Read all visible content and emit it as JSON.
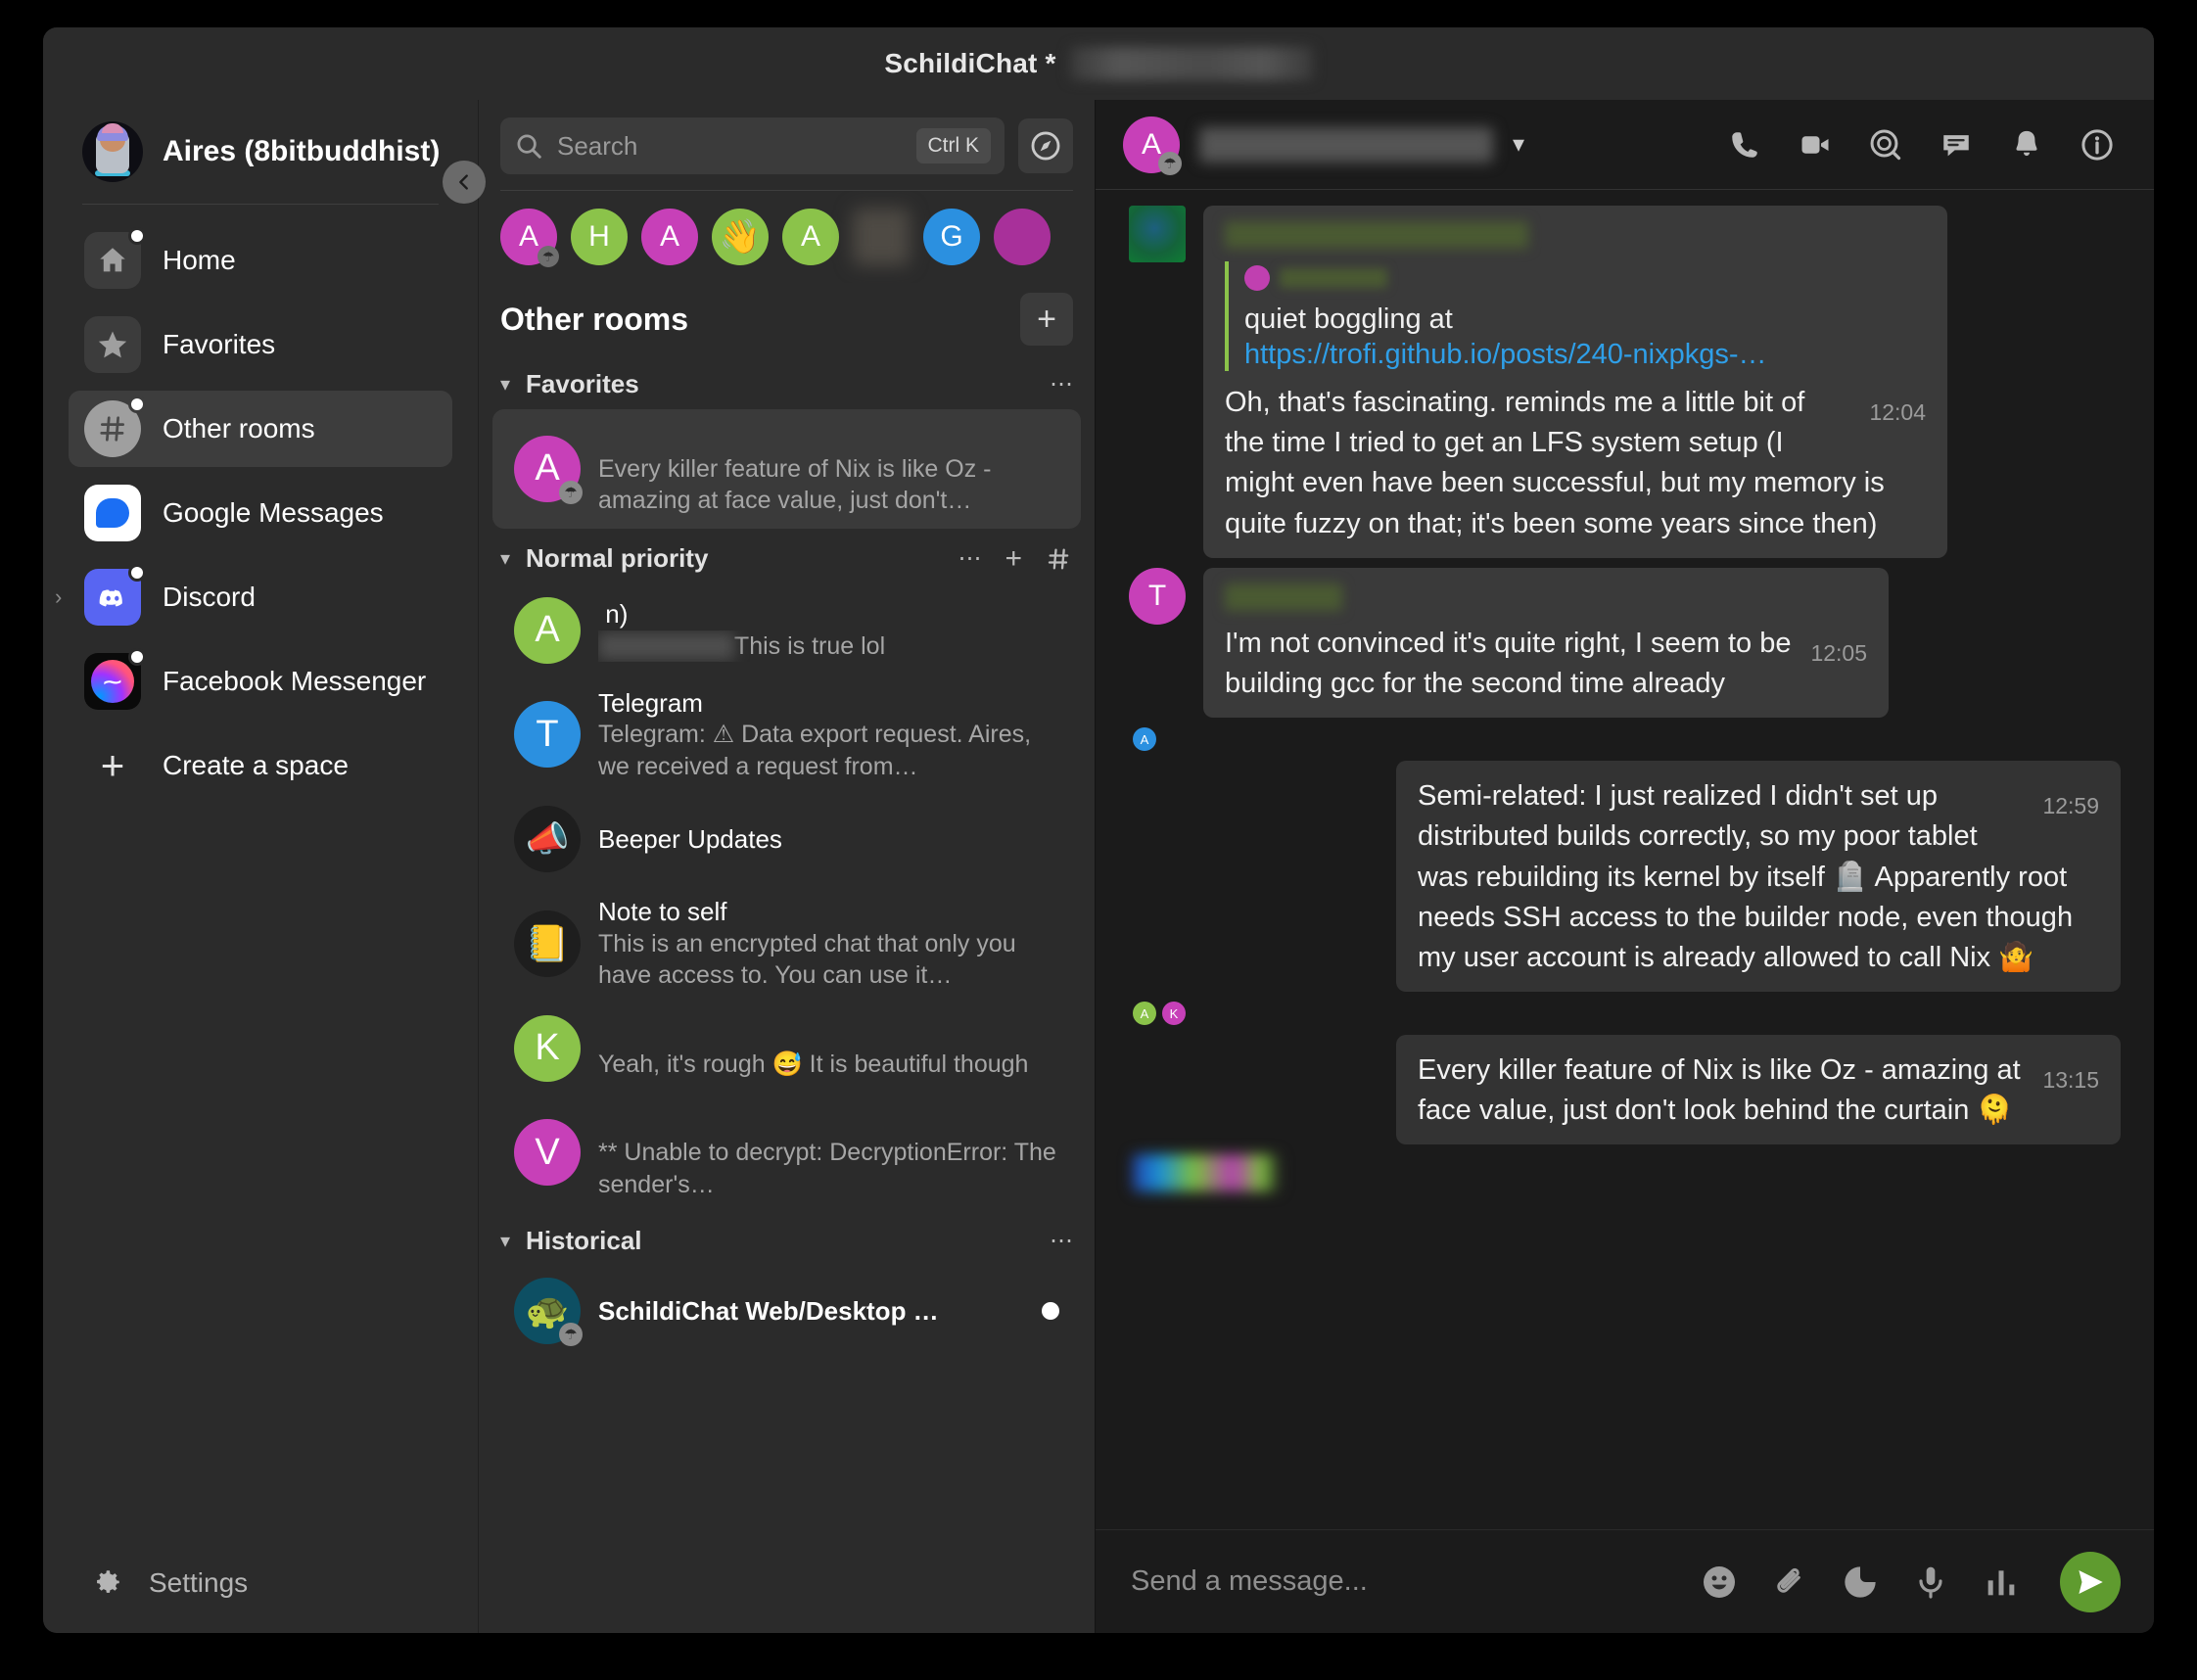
{
  "window": {
    "title_app": "SchildiChat *",
    "title_room_redacted": true
  },
  "sidebar": {
    "user": {
      "name": "Aires (8bitbuddhist)",
      "avatar": "user-avatar"
    },
    "collapse_icon": "chevron-left-icon",
    "items": [
      {
        "label": "Home",
        "icon": "home-icon",
        "badge": true,
        "selected": false
      },
      {
        "label": "Favorites",
        "icon": "star-icon",
        "badge": false,
        "selected": false
      },
      {
        "label": "Other rooms",
        "icon": "hash-icon",
        "badge": true,
        "selected": true
      },
      {
        "label": "Google Messages",
        "icon": "google-messages-icon",
        "badge": false,
        "selected": false
      },
      {
        "label": "Discord",
        "icon": "discord-icon",
        "badge": true,
        "selected": false,
        "expandable": true
      },
      {
        "label": "Facebook Messenger",
        "icon": "facebook-messenger-icon",
        "badge": true,
        "selected": false
      }
    ],
    "create_space_label": "Create a space",
    "settings_label": "Settings",
    "settings_icon": "gear-icon"
  },
  "roomlist": {
    "search": {
      "placeholder": "Search",
      "shortcut": "Ctrl K",
      "icon": "search-icon"
    },
    "explore_icon": "explore-compass-icon",
    "avatar_strip": [
      {
        "letter": "A",
        "color": "#c740b8",
        "globe": true
      },
      {
        "letter": "H",
        "color": "#8bc34a",
        "globe": false
      },
      {
        "letter": "A",
        "color": "#c740b8",
        "globe": false
      },
      {
        "letter": "👋",
        "color": "#8bc34a",
        "globe": false
      },
      {
        "letter": "A",
        "color": "#8bc34a",
        "globe": false
      },
      {
        "letter": "",
        "color": "#4a4a4a",
        "globe": false,
        "blurred": true
      },
      {
        "letter": "G",
        "color": "#2b90e0",
        "globe": false
      },
      {
        "letter": "",
        "color": "#a8309a",
        "globe": false
      }
    ],
    "header": {
      "title": "Other rooms",
      "add_icon": "plus-icon"
    },
    "sections": [
      {
        "name": "Favorites",
        "icons": [
          "overflow-icon"
        ],
        "rooms": [
          {
            "name_redacted": true,
            "name": "",
            "preview": "Every killer feature of Nix is like Oz - amazing at face value, just don't…",
            "preview_redacted_prefix": "",
            "avatar": {
              "letter": "A",
              "color": "#c740b8",
              "globe": true
            },
            "selected": true,
            "unread": false
          }
        ]
      },
      {
        "name": "Normal priority",
        "icons": [
          "overflow-icon",
          "plus-icon",
          "add-room-icon"
        ],
        "rooms": [
          {
            "name_redacted": true,
            "name": "",
            "name_suffix": "n)",
            "preview": "This is true lol",
            "preview_redacted_prefix": "  ",
            "avatar": {
              "letter": "A",
              "color": "#8bc34a",
              "globe": false
            },
            "selected": false,
            "unread": false
          },
          {
            "name_redacted": false,
            "name": "Telegram",
            "preview": "Telegram: ⚠ Data export request. Aires, we received a request from…",
            "avatar": {
              "letter": "T",
              "color": "#2b90e0",
              "globe": false
            },
            "selected": false,
            "unread": false
          },
          {
            "name_redacted": false,
            "name": "Beeper Updates",
            "preview": "",
            "avatar": {
              "letter": "📣",
              "color": "#1e1e1e",
              "globe": false
            },
            "selected": false,
            "unread": false
          },
          {
            "name_redacted": false,
            "name": "Note to self",
            "preview": "This is an encrypted chat that only you have access to. You can use it…",
            "avatar": {
              "letter": "📒",
              "color": "#1e1e1e",
              "globe": false
            },
            "selected": false,
            "unread": false
          },
          {
            "name_redacted": true,
            "name": "",
            "preview": "Yeah, it's rough 😅 It is beautiful though",
            "avatar": {
              "letter": "K",
              "color": "#8bc34a",
              "globe": false
            },
            "selected": false,
            "unread": false
          },
          {
            "name_redacted": true,
            "name": "",
            "preview": "** Unable to decrypt: DecryptionError: The sender's…",
            "avatar": {
              "letter": "V",
              "color": "#c740b8",
              "globe": false
            },
            "selected": false,
            "unread": false
          }
        ]
      },
      {
        "name": "Historical",
        "icons": [
          "overflow-icon"
        ],
        "rooms": [
          {
            "name_redacted": false,
            "name": "SchildiChat Web/Desktop …",
            "preview": "",
            "avatar": {
              "letter": "🐢",
              "color": "#0d4f63",
              "globe": true
            },
            "selected": false,
            "unread": true
          }
        ]
      }
    ]
  },
  "chat": {
    "header": {
      "room_name_redacted": true,
      "chevron_icon": "chevron-down-icon",
      "avatar": {
        "letter": "A",
        "color": "#c740b8",
        "globe": true
      },
      "icons": [
        "voice-call-icon",
        "video-call-icon",
        "search-in-room-icon",
        "threads-icon",
        "notifications-icon",
        "room-info-icon"
      ]
    },
    "messages": [
      {
        "id": "m1",
        "side": "left",
        "avatar": {
          "type": "image",
          "letter": ""
        },
        "sender_redacted": true,
        "quote": {
          "name_redacted": true,
          "text": "quiet boggling at",
          "link": "https://trofi.github.io/posts/240-nixpkgs-…"
        },
        "text": "Oh, that's fascinating. reminds me a little bit of the time I tried to get an LFS system setup (I might even have been successful, but my memory is quite fuzzy on that; it's been some years since then)",
        "time": "12:04"
      },
      {
        "id": "m2",
        "side": "left",
        "avatar": {
          "type": "letter",
          "letter": "T",
          "color": "#c740b8"
        },
        "sender_redacted": true,
        "text": "I'm not convinced it's quite right, I seem to be building gcc for the second time already",
        "time": "12:05",
        "receipts": [
          {
            "letter": "A",
            "color": "#2b90e0"
          }
        ]
      },
      {
        "id": "m3",
        "side": "own",
        "text": "Semi-related: I just realized I didn't set up distributed builds correctly, so my poor tablet was rebuilding its kernel by itself 🪦 Apparently root needs SSH access to the builder node, even though my user account is already allowed to call Nix 🤷",
        "time": "12:59",
        "receipts": [
          {
            "letter": "A",
            "color": "#8bc34a"
          },
          {
            "letter": "K",
            "color": "#c740b8"
          }
        ]
      },
      {
        "id": "m4",
        "side": "own",
        "text": "Every killer feature of Nix is like Oz - amazing at face value, just don't look behind the curtain 🫠",
        "time": "13:15",
        "receipts_redacted": true
      }
    ],
    "composer": {
      "placeholder": "Send a message...",
      "icons": [
        "emoji-icon",
        "attachment-icon",
        "sticker-icon",
        "voice-message-icon",
        "poll-icon"
      ],
      "send_icon": "send-icon",
      "send_color": "#5f9b2f"
    }
  },
  "colors": {
    "window_bg": "#181818",
    "sidebar_bg": "#2b2b2b",
    "timeline_bg": "#1b1b1b",
    "bubble": "#3a3a3a",
    "own_bubble": "#333333",
    "accent_green": "#8bc34a",
    "link": "#2f9fe8"
  }
}
